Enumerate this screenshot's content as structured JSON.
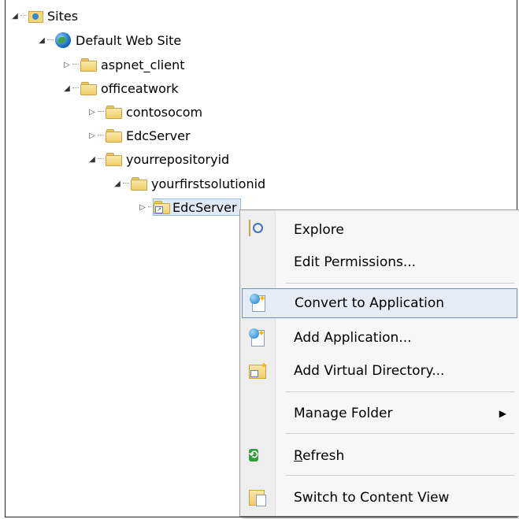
{
  "tree": {
    "sites": "Sites",
    "default_web_site": "Default Web Site",
    "aspnet_client": "aspnet_client",
    "officeatwork": "officeatwork",
    "contosocom": "contosocom",
    "edcserver_1": "EdcServer",
    "yourrepositoryid": "yourrepositoryid",
    "yourfirstsolutionid": "yourfirstsolutionid",
    "edcserver_selected": "EdcServer"
  },
  "menu": {
    "explore": "Explore",
    "edit_permissions": "Edit Permissions...",
    "convert_to_application": "Convert to Application",
    "add_application": "Add Application...",
    "add_virtual_directory": "Add Virtual Directory...",
    "manage_folder": "Manage Folder",
    "refresh_first": "R",
    "refresh_rest": "efresh",
    "switch_to_content_view": "Switch to Content View"
  },
  "colors": {
    "highlight_bg": "#e4ecf7",
    "highlight_border": "#6f8fc0",
    "selected_bg": "#dfeaf7"
  }
}
